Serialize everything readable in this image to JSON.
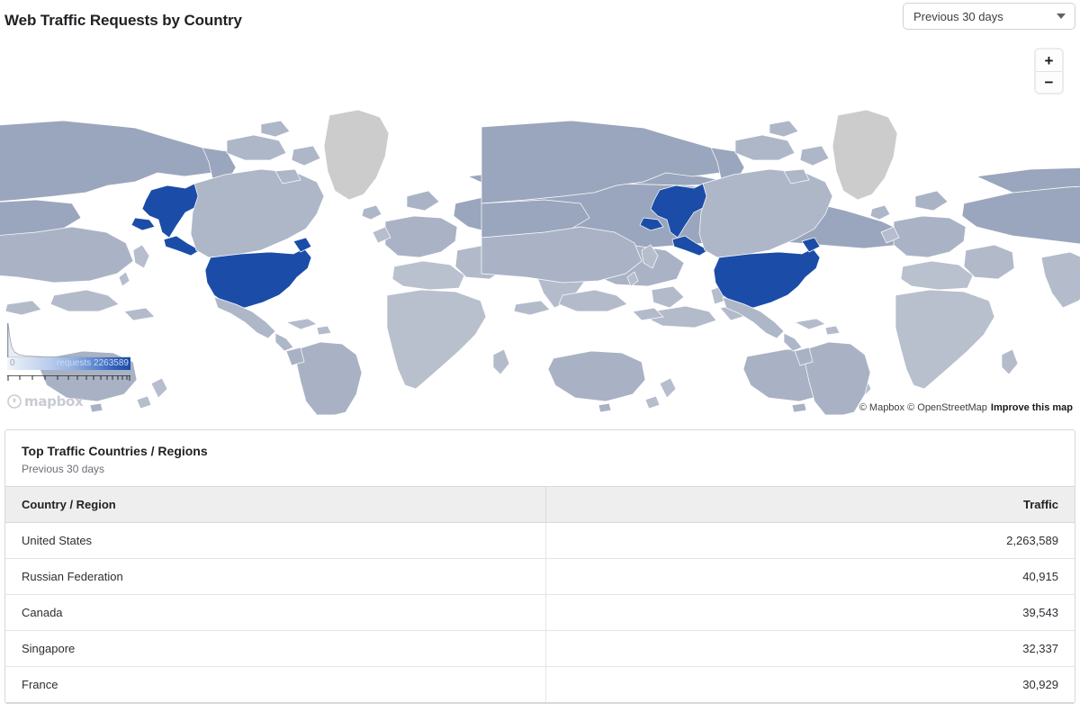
{
  "header": {
    "title": "Web Traffic Requests by Country",
    "range_select": {
      "value": "Previous 30 days",
      "caret_icon": "chevron-down-icon"
    }
  },
  "map": {
    "zoom_in_label": "+",
    "zoom_out_label": "−",
    "legend": {
      "min_label": "0",
      "max_label": "requests 2263589",
      "metric": "requests",
      "max_value": 2263589
    },
    "logo_text": "mapbox",
    "attribution": {
      "copyright": "© Mapbox © OpenStreetMap",
      "improve_link": "Improve this map"
    },
    "highlight_color": "#1b4da8",
    "land_color": "#aeb7c8",
    "nodata_color": "#cccccc",
    "water_color": "#ffffff",
    "highlighted_countries": [
      "United States"
    ]
  },
  "table_card": {
    "title": "Top Traffic Countries / Regions",
    "subtitle": "Previous 30 days",
    "columns": [
      "Country / Region",
      "Traffic"
    ],
    "rows": [
      {
        "country": "United States",
        "traffic": "2,263,589"
      },
      {
        "country": "Russian Federation",
        "traffic": "40,915"
      },
      {
        "country": "Canada",
        "traffic": "39,543"
      },
      {
        "country": "Singapore",
        "traffic": "32,337"
      },
      {
        "country": "France",
        "traffic": "30,929"
      }
    ]
  },
  "chart_data": {
    "type": "map",
    "title": "Web Traffic Requests by Country",
    "subtitle": "Previous 30 days",
    "metric": "requests",
    "categories": [
      "United States",
      "Russian Federation",
      "Canada",
      "Singapore",
      "France"
    ],
    "values": [
      2263589,
      40915,
      39543,
      32337,
      30929
    ],
    "color_scale": {
      "min": 0,
      "max": 2263589,
      "low_color": "#f2f6fb",
      "high_color": "#1b4da8"
    },
    "legend_position": "bottom-left",
    "grid": false
  }
}
